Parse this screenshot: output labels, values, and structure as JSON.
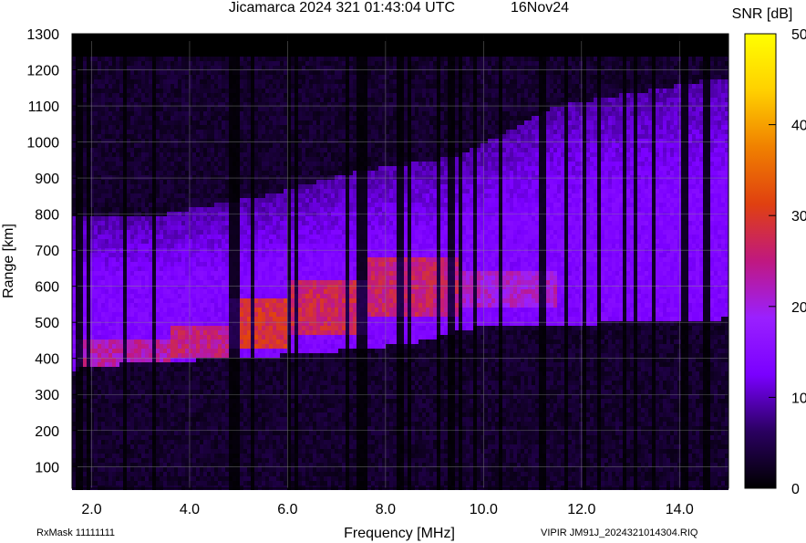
{
  "header": {
    "title": "Jicamarca 2024 321 01:43:04 UTC",
    "date": "16Nov24"
  },
  "footer": {
    "rxmask": "RxMask 11111111",
    "file_label": "VIPIR  JM91J_2024321014304.RIQ"
  },
  "chart_data": {
    "type": "heatmap",
    "xlabel": "Frequency [MHz]",
    "ylabel": "Range [km]",
    "x_ticks": [
      "2.0",
      "4.0",
      "6.0",
      "8.0",
      "10.0",
      "12.0",
      "14.0"
    ],
    "x_tick_values": [
      2,
      4,
      6,
      8,
      10,
      12,
      14
    ],
    "y_ticks": [
      "100",
      "200",
      "300",
      "400",
      "500",
      "600",
      "700",
      "800",
      "900",
      "1000",
      "1100",
      "1200",
      "1300"
    ],
    "y_tick_values": [
      100,
      200,
      300,
      400,
      500,
      600,
      700,
      800,
      900,
      1000,
      1100,
      1200,
      1300
    ],
    "xlim": [
      1.6,
      15.0
    ],
    "ylim": [
      40,
      1300
    ],
    "data_range_max_km": 1240,
    "grid": true,
    "colorbar": {
      "label": "SNR [dB]",
      "ticks": [
        "0",
        "10",
        "20",
        "30",
        "40",
        "50"
      ],
      "tick_values": [
        0,
        10,
        20,
        30,
        40,
        50
      ],
      "range": [
        0,
        50
      ],
      "colormap": [
        "#000000",
        "#2a0060",
        "#7a00ff",
        "#9a20ff",
        "#c01880",
        "#e04010",
        "#f08000",
        "#ffd000",
        "#ffff00"
      ]
    },
    "layers": [
      {
        "name": "F-trace base",
        "x": [
          1.7,
          3.0,
          5.0,
          7.0,
          8.5,
          10.0,
          12.0,
          15.0
        ],
        "y_base_km": [
          380,
          400,
          410,
          430,
          450,
          500,
          505,
          520
        ]
      },
      {
        "name": "upper boundary",
        "x": [
          1.7,
          3.5,
          5.5,
          7.5,
          9.5,
          11.5,
          15.0
        ],
        "y_top_km": [
          790,
          800,
          850,
          920,
          960,
          1100,
          1180
        ]
      }
    ],
    "peak_regions": [
      {
        "x_range": [
          1.7,
          3.6
        ],
        "y_range_km": [
          380,
          450
        ],
        "snr_db": 26
      },
      {
        "x_range": [
          3.6,
          4.8
        ],
        "y_range_km": [
          400,
          490
        ],
        "snr_db": 28
      },
      {
        "x_range": [
          4.8,
          6.0
        ],
        "y_range_km": [
          430,
          560
        ],
        "snr_db": 32
      },
      {
        "x_range": [
          6.0,
          7.6
        ],
        "y_range_km": [
          460,
          620
        ],
        "snr_db": 30
      },
      {
        "x_range": [
          7.6,
          9.5
        ],
        "y_range_km": [
          520,
          680
        ],
        "snr_db": 29
      },
      {
        "x_range": [
          9.5,
          11.5
        ],
        "y_range_km": [
          540,
          640
        ],
        "snr_db": 24
      }
    ],
    "dark_columns_mhz": [
      1.75,
      1.95,
      2.7,
      3.3,
      4.83,
      4.95,
      5.3,
      6.05,
      6.2,
      7.2,
      7.45,
      7.55,
      8.3,
      8.5,
      9.1,
      9.35,
      9.5,
      9.8,
      10.35,
      11.2,
      11.7,
      12.05,
      12.35,
      12.85,
      13.1,
      13.5,
      14.1,
      14.55
    ]
  }
}
